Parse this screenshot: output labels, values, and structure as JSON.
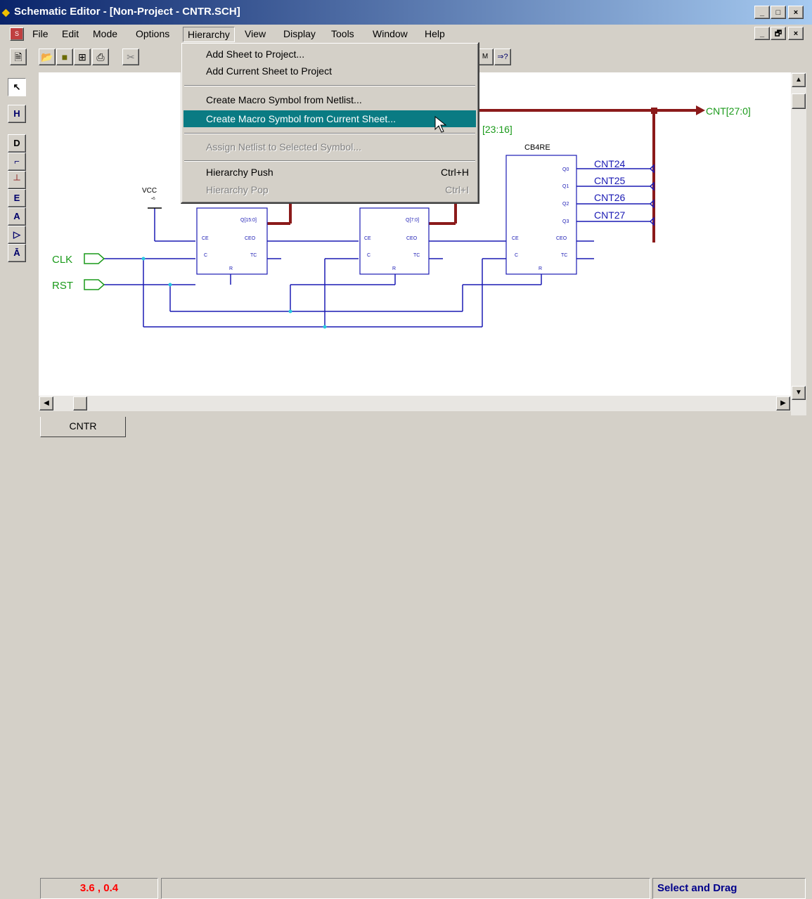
{
  "window": {
    "title": "Schematic Editor - [Non-Project - CNTR.SCH]",
    "controls": [
      "_",
      "□",
      "×"
    ],
    "doc_controls": [
      "_",
      "🗗",
      "×"
    ]
  },
  "menubar": {
    "items": [
      {
        "label": "File"
      },
      {
        "label": "Edit"
      },
      {
        "label": "Mode"
      },
      {
        "label": "Options"
      },
      {
        "label": "Hierarchy"
      },
      {
        "label": "View"
      },
      {
        "label": "Display"
      },
      {
        "label": "Tools"
      },
      {
        "label": "Window"
      },
      {
        "label": "Help"
      }
    ]
  },
  "hierarchy_menu": {
    "add_sheet": "Add Sheet to Project...",
    "add_current": "Add Current Sheet to Project",
    "create_from_netlist": "Create Macro Symbol from Netlist...",
    "create_from_current": "Create Macro Symbol from Current Sheet...",
    "assign_netlist": "Assign Netlist to Selected Symbol...",
    "push": "Hierarchy Push",
    "push_shortcut": "Ctrl+H",
    "pop": "Hierarchy Pop",
    "pop_shortcut": "Ctrl+I"
  },
  "schematic": {
    "bus_out_label": "CNT[27:0]",
    "bus_partial_label": "[23:16]",
    "component_name": "CB4RE",
    "vcc_label": "VCC",
    "vcc_sub": "+5",
    "inputs": [
      "CLK",
      "RST"
    ],
    "outputs": [
      "CNT24",
      "CNT25",
      "CNT26",
      "CNT27"
    ],
    "counter1": {
      "q": "Q[15:0]",
      "ce": "CE",
      "ceo": "CEO",
      "c": "C",
      "tc": "TC",
      "r": "R"
    },
    "counter2": {
      "q": "Q[7:0]",
      "ce": "CE",
      "ceo": "CEO",
      "c": "C",
      "tc": "TC",
      "r": "R"
    },
    "counter3": {
      "q0": "Q0",
      "q1": "Q1",
      "q2": "Q2",
      "q3": "Q3",
      "ce": "CE",
      "ceo": "CEO",
      "c": "C",
      "tc": "TC",
      "r": "R"
    }
  },
  "tabs": {
    "active": "CNTR"
  },
  "status": {
    "coords": "3.6 ,  0.4",
    "message": "",
    "mode": "Select and Drag"
  },
  "colors": {
    "accent": "#0a7b83",
    "bus": "#8b1a1a",
    "wire": "#1a1ab4",
    "label": "#1a9a1a",
    "status_red": "#ff0000",
    "status_blue": "#00008b"
  }
}
